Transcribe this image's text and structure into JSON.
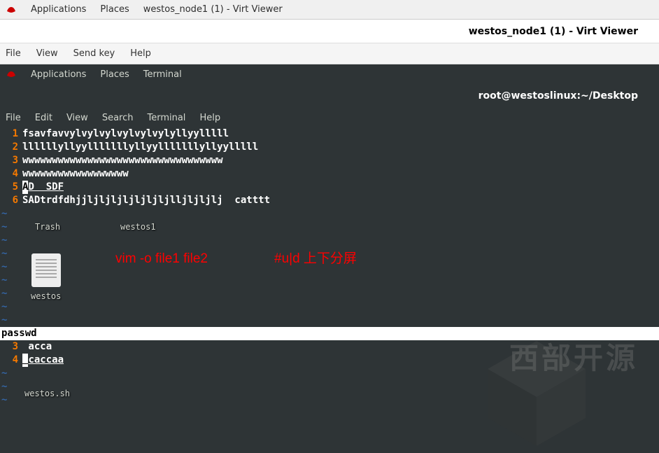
{
  "host": {
    "applications": "Applications",
    "places": "Places",
    "app_title": "westos_node1 (1) - Virt Viewer"
  },
  "window_title": "westos_node1 (1) - Virt Viewer",
  "viewer_menu": {
    "file": "File",
    "view": "View",
    "send_key": "Send key",
    "help": "Help"
  },
  "guest": {
    "applications": "Applications",
    "places": "Places",
    "terminal": "Terminal"
  },
  "guest_title": "root@westoslinux:~/Desktop",
  "terminal_menu": {
    "file": "File",
    "edit": "Edit",
    "view": "View",
    "search": "Search",
    "terminal": "Terminal",
    "help": "Help"
  },
  "editor_top": {
    "lines": [
      {
        "n": "1",
        "t": "fsavfavvylvylvylvylvylvylyllyylllll"
      },
      {
        "n": "2",
        "t": "llllllyllyylllllllyllyylllllllyllyylllll"
      },
      {
        "n": "3",
        "t": "wwwwwwwwwwwwwwwwwwwwwwwwwwwwwwwwww"
      },
      {
        "n": "4",
        "t": "wwwwwwwwwwwwwwwwww"
      },
      {
        "n": "5",
        "cursor": "A",
        "t_after": "D  SDF"
      },
      {
        "n": "6",
        "t": "SADtrdfdhjjljljljljljljljlljljljlj  catttt"
      }
    ]
  },
  "status_top": "passwd",
  "editor_bottom": {
    "lines": [
      {
        "n": "3",
        "t": " acca"
      },
      {
        "n": "4",
        "cursor": " ",
        "t_after": "caccaa"
      }
    ]
  },
  "desktop": {
    "trash": "Trash",
    "westos1": "westos1",
    "westos": "westos",
    "westos_sh": "westos.sh"
  },
  "annotations": {
    "cmd": "vim -o file1 file2",
    "comment": "#u|d 上下分屏"
  },
  "watermark": "西部开源",
  "tilde": "~"
}
